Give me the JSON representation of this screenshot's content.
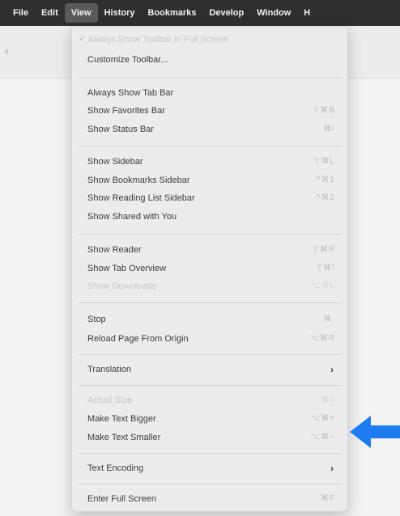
{
  "menubar": {
    "items": [
      {
        "label": "File"
      },
      {
        "label": "Edit"
      },
      {
        "label": "View"
      },
      {
        "label": "History"
      },
      {
        "label": "Bookmarks"
      },
      {
        "label": "Develop"
      },
      {
        "label": "Window"
      },
      {
        "label": "H"
      }
    ]
  },
  "toolbar": {
    "left_glyph": "‹",
    "right_icon_glyph": "▯"
  },
  "menu": {
    "always_show_toolbar": {
      "check": "✓",
      "label": "Always Show Toolbar in Full Screen"
    },
    "customize_toolbar": {
      "label": "Customize Toolbar..."
    },
    "always_show_tab_bar": {
      "label": "Always Show Tab Bar"
    },
    "show_favorites_bar": {
      "label": "Show Favorites Bar",
      "shortcut": "⇧⌘B"
    },
    "show_status_bar": {
      "label": "Show Status Bar",
      "shortcut": "⌘/"
    },
    "show_sidebar": {
      "label": "Show Sidebar",
      "shortcut": "⇧⌘L"
    },
    "show_bookmarks_sidebar": {
      "label": "Show Bookmarks Sidebar",
      "shortcut": "^⌘1"
    },
    "show_reading_list_sidebar": {
      "label": "Show Reading List Sidebar",
      "shortcut": "^⌘2"
    },
    "show_shared_with_you": {
      "label": "Show Shared with You"
    },
    "show_reader": {
      "label": "Show Reader",
      "shortcut": "⇧⌘R"
    },
    "show_tab_overview": {
      "label": "Show Tab Overview",
      "shortcut": "⇧⌘\\"
    },
    "show_downloads": {
      "label": "Show Downloads",
      "shortcut": "⌥⌘L"
    },
    "stop": {
      "label": "Stop",
      "shortcut": "⌘."
    },
    "reload_page": {
      "label": "Reload Page From Origin",
      "shortcut": "⌥⌘R"
    },
    "translation": {
      "label": "Translation",
      "arrow": "›"
    },
    "actual_size": {
      "label": "Actual Size",
      "shortcut": "⌘0"
    },
    "make_text_bigger": {
      "label": "Make Text Bigger",
      "shortcut": "⌥⌘+"
    },
    "make_text_smaller": {
      "label": "Make Text Smaller",
      "shortcut": "⌥⌘−"
    },
    "text_encoding": {
      "label": "Text Encoding",
      "arrow": "›"
    },
    "enter_full_screen": {
      "label": "Enter Full Screen",
      "shortcut": "⌘F"
    }
  },
  "colors": {
    "menubar_bg": "#2f2f2f",
    "menu_bg": "#ececec",
    "annotation_arrow": "#1f7cf0"
  }
}
